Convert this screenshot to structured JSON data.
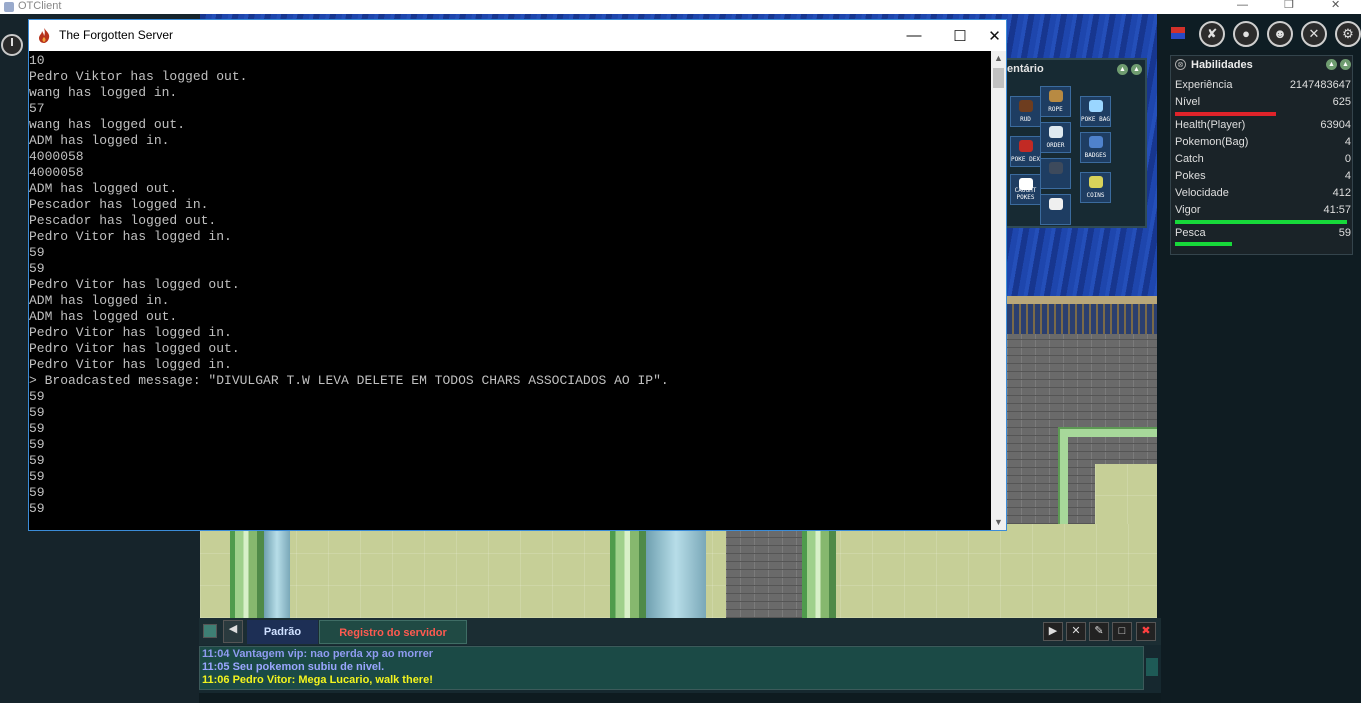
{
  "app_window": {
    "title": "OTClient"
  },
  "console": {
    "title": "The Forgotten Server",
    "lines": [
      "10",
      "Pedro Viktor has logged out.",
      "wang has logged in.",
      "57",
      "wang has logged out.",
      "ADM has logged in.",
      "4000058",
      "4000058",
      "ADM has logged out.",
      "Pescador has logged in.",
      "Pescador has logged out.",
      "Pedro Vitor has logged in.",
      "59",
      "59",
      "Pedro Vitor has logged out.",
      "ADM has logged in.",
      "ADM has logged out.",
      "Pedro Vitor has logged in.",
      "Pedro Vitor has logged out.",
      "Pedro Vitor has logged in.",
      "> Broadcasted message: \"DIVULGAR T.W LEVA DELETE EM TODOS CHARS ASSOCIADOS AO IP\".",
      "59",
      "59",
      "59",
      "59",
      "59",
      "59",
      "59",
      "59"
    ]
  },
  "inventory": {
    "title": "entário",
    "slots": [
      "RUD",
      "ROPE",
      "POKE BAG",
      "POKE DEX",
      "ORDER",
      "BADGES",
      "CAUGHT POKES",
      "",
      "COINS",
      ""
    ]
  },
  "skills": {
    "title": "Habilidades",
    "rows": [
      {
        "name": "Experiência",
        "value": "2147483647"
      },
      {
        "name": "Nível",
        "value": "625"
      },
      {
        "name": "Health(Player)",
        "value": "63904"
      },
      {
        "name": "Pokemon(Bag)",
        "value": "4"
      },
      {
        "name": "Catch",
        "value": "0"
      },
      {
        "name": "Pokes",
        "value": "4"
      },
      {
        "name": "Velocidade",
        "value": "412"
      },
      {
        "name": "Vigor",
        "value": "41:57"
      },
      {
        "name": "Pesca",
        "value": "59"
      }
    ],
    "colors": {
      "level_bar": "#e0232a",
      "vigor_bar": "#17d93a",
      "pesca_bar": "#17d93a"
    }
  },
  "chat": {
    "tabs": [
      {
        "label": "Padrão",
        "active": true
      },
      {
        "label": "Registro do servidor",
        "active": false
      }
    ],
    "messages": [
      {
        "text": "11:04 Vantagem vip: nao perda xp ao morrer",
        "color": "#8f9bf0"
      },
      {
        "text": "11:05 Seu pokemon subiu de nivel.",
        "color": "#9aa6ff"
      },
      {
        "text": "11:06 Pedro Vitor: Mega Lucario, walk there!",
        "color": "#f4f41e"
      }
    ]
  },
  "icons": {
    "power": "power-icon",
    "close": "close-icon",
    "maximize": "maximize-icon",
    "minimize": "minimize-icon"
  }
}
